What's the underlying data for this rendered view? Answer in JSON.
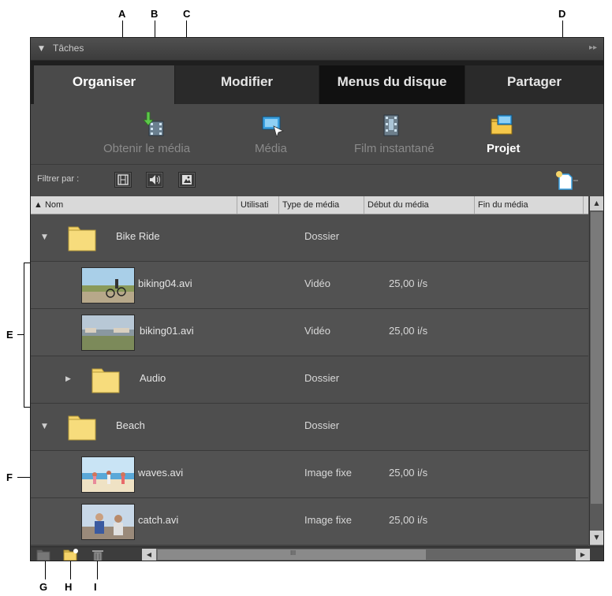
{
  "callouts": {
    "A": "A",
    "B": "B",
    "C": "C",
    "D": "D",
    "E": "E",
    "F": "F",
    "G": "G",
    "H": "H",
    "I": "I"
  },
  "taskbar": {
    "title": "Tâches",
    "collapse_icon": "triangle-down-icon",
    "expand_icon": "double-chevron-right-icon"
  },
  "tabs": [
    {
      "label": "Organiser",
      "active": true
    },
    {
      "label": "Modifier",
      "active": false
    },
    {
      "label": "Menus du disque",
      "active": false
    },
    {
      "label": "Partager",
      "active": false
    }
  ],
  "toolbar": {
    "get_media": "Obtenir le média",
    "media": "Média",
    "instant_movie": "Film instantané",
    "project": "Projet"
  },
  "filter": {
    "label": "Filtrer par :"
  },
  "columns": {
    "name": "▲ Nom",
    "usage": "Utilisati",
    "type": "Type de média",
    "start": "Début du média",
    "end": "Fin du média"
  },
  "rows": [
    {
      "kind": "folder",
      "name": "Bike Ride",
      "type": "Dossier",
      "start": ""
    },
    {
      "kind": "media",
      "name": "biking04.avi",
      "type": "Vidéo",
      "start": "25,00 i/s"
    },
    {
      "kind": "media",
      "name": "biking01.avi",
      "type": "Vidéo",
      "start": "25,00 i/s"
    },
    {
      "kind": "subfolder",
      "name": "Audio",
      "type": "Dossier",
      "start": ""
    },
    {
      "kind": "folder",
      "name": "Beach",
      "type": "Dossier",
      "start": ""
    },
    {
      "kind": "media",
      "name": "waves.avi",
      "type": "Image fixe",
      "start": "25,00 i/s"
    },
    {
      "kind": "media",
      "name": "catch.avi",
      "type": "Image fixe",
      "start": "25,00 i/s"
    }
  ],
  "colors": {
    "panel": "#4a4a4a",
    "tab_bg": "#1f1f1f",
    "folder_yellow": "#f5d46a",
    "accent_blue": "#3aa0e0"
  }
}
